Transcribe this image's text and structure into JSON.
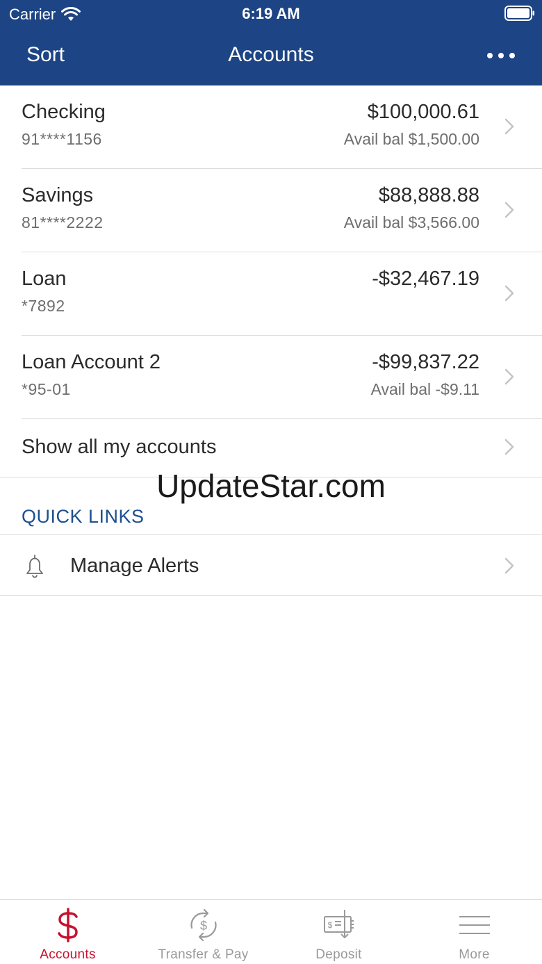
{
  "status_bar": {
    "carrier": "Carrier",
    "time": "6:19 AM"
  },
  "nav": {
    "left_button": "Sort",
    "title": "Accounts",
    "right_icon": "more-dots-icon"
  },
  "accounts": [
    {
      "name": "Checking",
      "number": "91****1156",
      "balance": "$100,000.61",
      "avail": "Avail bal $1,500.00"
    },
    {
      "name": "Savings",
      "number": "81****2222",
      "balance": "$88,888.88",
      "avail": "Avail bal $3,566.00"
    },
    {
      "name": "Loan",
      "number": "*7892",
      "balance": "-$32,467.19",
      "avail": ""
    },
    {
      "name": "Loan Account 2",
      "number": "*95-01",
      "balance": "-$99,837.22",
      "avail": "Avail bal -$9.11"
    }
  ],
  "show_all": {
    "label": "Show all my accounts"
  },
  "watermark": "UpdateStar.com",
  "quick_links": {
    "title": "QUICK LINKS",
    "items": [
      {
        "label": "Manage Alerts",
        "icon": "bell-icon"
      }
    ]
  },
  "tabbar": {
    "tabs": [
      {
        "label": "Accounts",
        "icon": "dollar-icon",
        "active": true
      },
      {
        "label": "Transfer & Pay",
        "icon": "transfer-icon",
        "active": false
      },
      {
        "label": "Deposit",
        "icon": "deposit-check-icon",
        "active": false
      },
      {
        "label": "More",
        "icon": "hamburger-icon",
        "active": false
      }
    ]
  },
  "colors": {
    "header_bg": "#1d4484",
    "accent_red": "#c8102e",
    "link_blue": "#1d4f91",
    "inactive_gray": "#9a9a9a"
  }
}
